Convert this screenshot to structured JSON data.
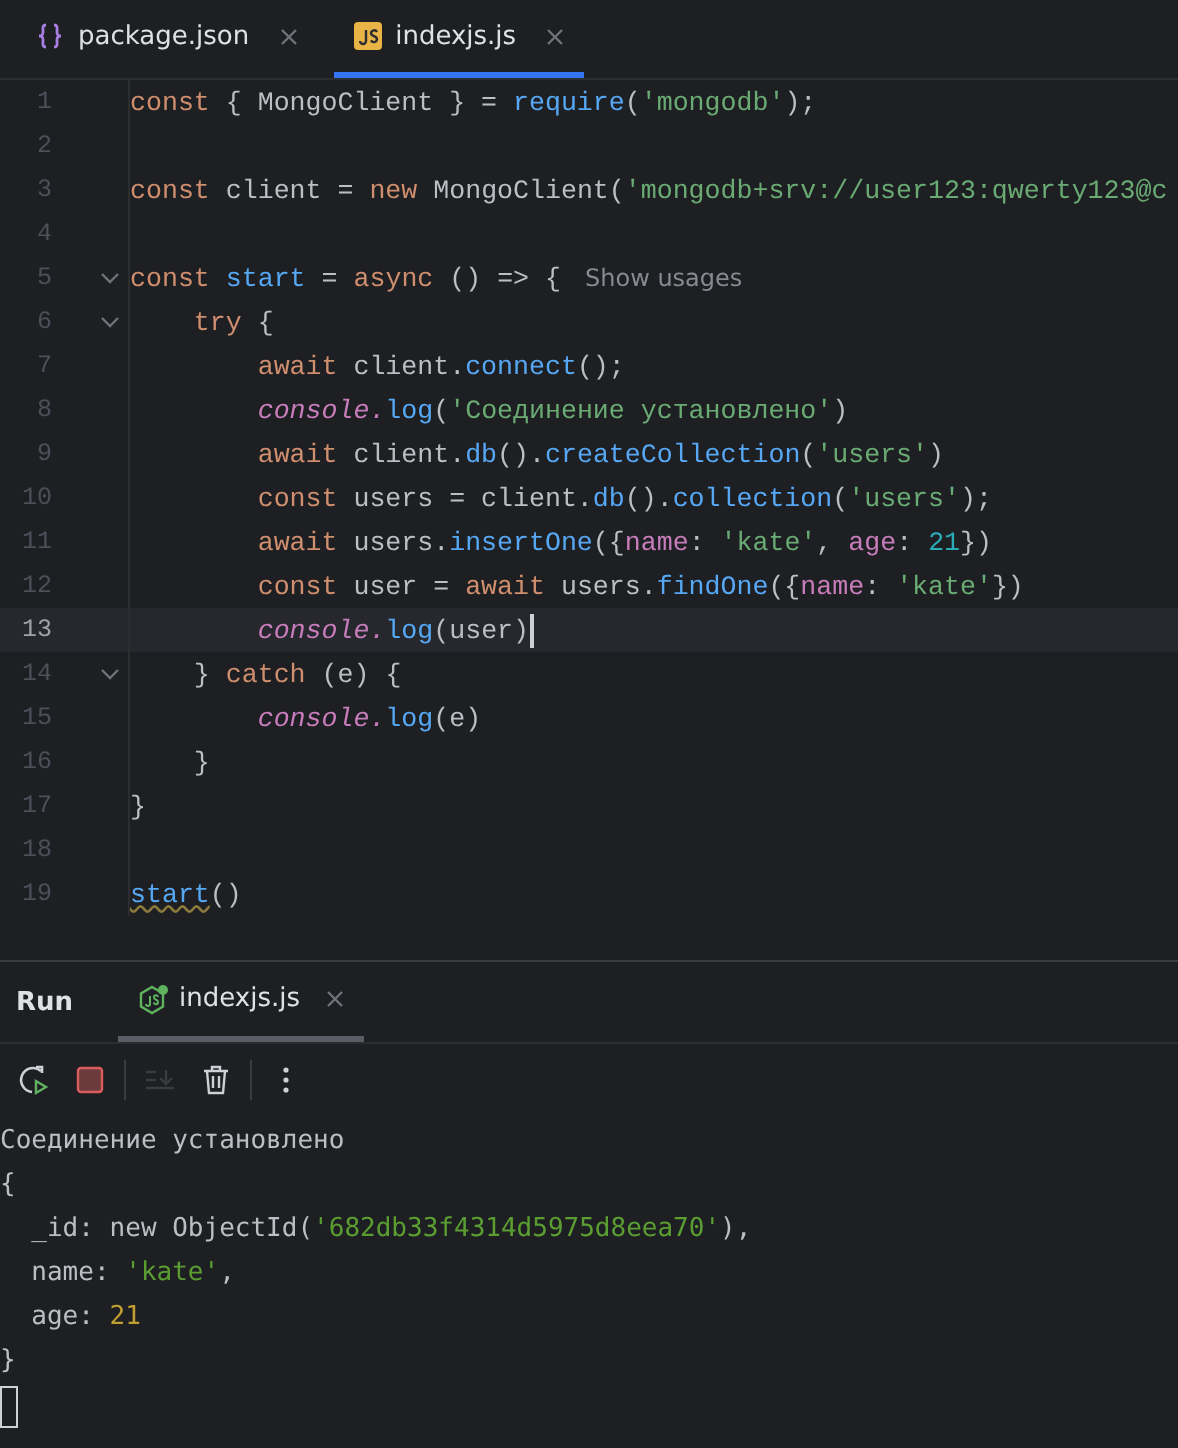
{
  "editor_tabs": [
    {
      "label": "package.json",
      "kind": "json",
      "selected": false
    },
    {
      "label": "indexjs.js",
      "kind": "js",
      "selected": true
    }
  ],
  "code_lines": [
    {
      "number": "1",
      "fold": false,
      "current": false,
      "tokens": [
        {
          "t": "const",
          "kind": "kw"
        },
        {
          "t": " { MongoClient } = ",
          "kind": "p"
        },
        {
          "t": "require",
          "kind": "fn"
        },
        {
          "t": "(",
          "kind": "p"
        },
        {
          "t": "'mongodb'",
          "kind": "str"
        },
        {
          "t": ");",
          "kind": "p"
        }
      ]
    },
    {
      "number": "2",
      "fold": false,
      "current": false
    },
    {
      "number": "3",
      "fold": false,
      "current": false,
      "tokens": [
        {
          "t": "const",
          "kind": "kw"
        },
        {
          "t": " client = ",
          "kind": "p"
        },
        {
          "t": "new",
          "kind": "kw"
        },
        {
          "t": " MongoClient(",
          "kind": "p"
        },
        {
          "t": "'mongodb+srv://user123:qwerty123@c",
          "kind": "str"
        }
      ]
    },
    {
      "number": "4",
      "fold": false,
      "current": false
    },
    {
      "number": "5",
      "fold": true,
      "current": false,
      "hint": "Show usages",
      "tokens": [
        {
          "t": "const",
          "kind": "kw"
        },
        {
          "t": " start",
          "kind": "fn"
        },
        {
          "t": " = ",
          "kind": "p"
        },
        {
          "t": "async",
          "kind": "kw"
        },
        {
          "t": " () => {",
          "kind": "p"
        }
      ]
    },
    {
      "number": "6",
      "fold": true,
      "current": false,
      "tokens": [
        {
          "t": "    try",
          "kind": "kw"
        },
        {
          "t": " {",
          "kind": "p"
        }
      ]
    },
    {
      "number": "7",
      "fold": false,
      "current": false,
      "tokens": [
        {
          "t": "        await",
          "kind": "kw"
        },
        {
          "t": " client.",
          "kind": "p"
        },
        {
          "t": "connect",
          "kind": "fn"
        },
        {
          "t": "();",
          "kind": "p"
        }
      ]
    },
    {
      "number": "8",
      "fold": false,
      "current": false,
      "tokens": [
        {
          "t": "        console.",
          "kind": "con"
        },
        {
          "t": "log",
          "kind": "fn"
        },
        {
          "t": "(",
          "kind": "p"
        },
        {
          "t": "'Соединение установлено'",
          "kind": "str"
        },
        {
          "t": ")",
          "kind": "p"
        }
      ]
    },
    {
      "number": "9",
      "fold": false,
      "current": false,
      "tokens": [
        {
          "t": "        await",
          "kind": "kw"
        },
        {
          "t": " client.",
          "kind": "p"
        },
        {
          "t": "db",
          "kind": "fn"
        },
        {
          "t": "().",
          "kind": "p"
        },
        {
          "t": "createCollection",
          "kind": "fn"
        },
        {
          "t": "(",
          "kind": "p"
        },
        {
          "t": "'users'",
          "kind": "str"
        },
        {
          "t": ")",
          "kind": "p"
        }
      ]
    },
    {
      "number": "10",
      "fold": false,
      "current": false,
      "tokens": [
        {
          "t": "        const",
          "kind": "kw"
        },
        {
          "t": " users = client.",
          "kind": "p"
        },
        {
          "t": "db",
          "kind": "fn"
        },
        {
          "t": "().",
          "kind": "p"
        },
        {
          "t": "collection",
          "kind": "fn"
        },
        {
          "t": "(",
          "kind": "p"
        },
        {
          "t": "'users'",
          "kind": "str"
        },
        {
          "t": ");",
          "kind": "p"
        }
      ]
    },
    {
      "number": "11",
      "fold": false,
      "current": false,
      "tokens": [
        {
          "t": "        await",
          "kind": "kw"
        },
        {
          "t": " users.",
          "kind": "p"
        },
        {
          "t": "insertOne",
          "kind": "fn"
        },
        {
          "t": "({",
          "kind": "p"
        },
        {
          "t": "name",
          "kind": "prop"
        },
        {
          "t": ": ",
          "kind": "p"
        },
        {
          "t": "'kate'",
          "kind": "str"
        },
        {
          "t": ", ",
          "kind": "p"
        },
        {
          "t": "age",
          "kind": "prop"
        },
        {
          "t": ": ",
          "kind": "p"
        },
        {
          "t": "21",
          "kind": "num"
        },
        {
          "t": "})",
          "kind": "p"
        }
      ]
    },
    {
      "number": "12",
      "fold": false,
      "current": false,
      "tokens": [
        {
          "t": "        const",
          "kind": "kw"
        },
        {
          "t": " user = ",
          "kind": "p"
        },
        {
          "t": "await",
          "kind": "kw"
        },
        {
          "t": " users.",
          "kind": "p"
        },
        {
          "t": "findOne",
          "kind": "fn"
        },
        {
          "t": "({",
          "kind": "p"
        },
        {
          "t": "name",
          "kind": "prop"
        },
        {
          "t": ": ",
          "kind": "p"
        },
        {
          "t": "'kate'",
          "kind": "str"
        },
        {
          "t": "})",
          "kind": "p"
        }
      ]
    },
    {
      "number": "13",
      "fold": false,
      "current": true,
      "tokens": [
        {
          "t": "        console.",
          "kind": "con"
        },
        {
          "t": "log",
          "kind": "fn"
        },
        {
          "t": "(user)",
          "kind": "p"
        }
      ]
    },
    {
      "number": "14",
      "fold": true,
      "current": false,
      "tokens": [
        {
          "t": "    } ",
          "kind": "p"
        },
        {
          "t": "catch",
          "kind": "kw"
        },
        {
          "t": " (e) {",
          "kind": "p"
        }
      ]
    },
    {
      "number": "15",
      "fold": false,
      "current": false,
      "tokens": [
        {
          "t": "        console.",
          "kind": "con"
        },
        {
          "t": "log",
          "kind": "fn"
        },
        {
          "t": "(e)",
          "kind": "p"
        }
      ]
    },
    {
      "number": "16",
      "fold": false,
      "current": false,
      "tokens": [
        {
          "t": "    }",
          "kind": "p"
        }
      ]
    },
    {
      "number": "17",
      "fold": false,
      "current": false,
      "tokens": [
        {
          "t": "}",
          "kind": "p"
        }
      ]
    },
    {
      "number": "18",
      "fold": false,
      "current": false
    },
    {
      "number": "19",
      "fold": false,
      "current": false,
      "tokens": [
        {
          "t": "start",
          "kind": "fnw"
        },
        {
          "t": "()",
          "kind": "p"
        }
      ]
    }
  ],
  "run_panel": {
    "title": "Run",
    "tabs": [
      {
        "label": "indexjs.js",
        "selected": true
      }
    ],
    "toolbar": [
      {
        "kind": "rerun",
        "disabled": false
      },
      {
        "kind": "stop",
        "disabled": false
      },
      {
        "kind": "scroll-end",
        "disabled": true
      },
      {
        "kind": "clear",
        "disabled": false
      },
      {
        "kind": "more",
        "disabled": false
      }
    ],
    "console_lines": [
      [
        {
          "t": "Соединение установлено",
          "kind": "p"
        }
      ],
      [
        {
          "t": "{",
          "kind": "p"
        }
      ],
      [
        {
          "t": "  _id: new ObjectId(",
          "kind": "p"
        },
        {
          "t": "'682db33f4314d5975d8eea70'",
          "kind": "str"
        },
        {
          "t": "),",
          "kind": "p"
        }
      ],
      [
        {
          "t": "  name: ",
          "kind": "p"
        },
        {
          "t": "'kate'",
          "kind": "str"
        },
        {
          "t": ",",
          "kind": "p"
        }
      ],
      [
        {
          "t": "  age: ",
          "kind": "p"
        },
        {
          "t": "21",
          "kind": "num"
        }
      ],
      [
        {
          "t": "}",
          "kind": "p"
        }
      ]
    ]
  }
}
